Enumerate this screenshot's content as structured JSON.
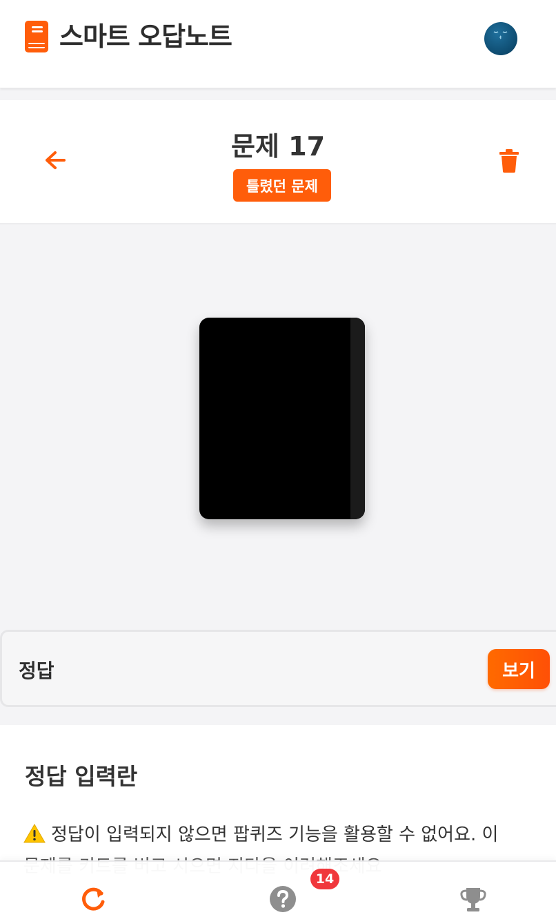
{
  "app": {
    "title": "스마트 오답노트",
    "logo_icon": "book-icon",
    "avatar_icon": "user-avatar"
  },
  "problem": {
    "title": "문제 17",
    "status": "틀렸던 문제",
    "back_icon": "arrow-left-icon",
    "delete_icon": "trash-icon"
  },
  "answer": {
    "label": "정답",
    "show_button": "보기"
  },
  "answer_input": {
    "title": "정답 입력란",
    "warning_text": "정답이 입력되지 않으면 팝퀴즈 기능을 활용할 수 없어요. 이",
    "warning_text_2": "문제를 키트를 버고 시으면 지다을 이려해조세요",
    "warning_icon": "warning-icon"
  },
  "bottom_nav": {
    "items": [
      {
        "icon": "retry-icon",
        "label": ""
      },
      {
        "icon": "question-icon",
        "label": "",
        "badge": "14"
      },
      {
        "icon": "trophy-icon",
        "label": ""
      }
    ]
  },
  "colors": {
    "accent": "#ff5d0a",
    "badge_red": "#f0373c",
    "muted_icon": "#8e8e8e"
  }
}
